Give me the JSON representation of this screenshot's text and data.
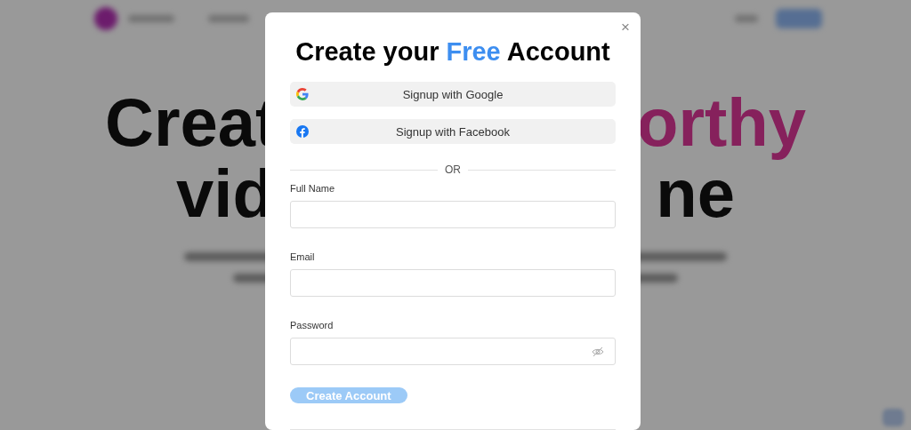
{
  "background_page": {
    "headline": [
      {
        "text": "Creat",
        "accent": false
      },
      {
        "text": "orthy",
        "accent": true
      },
      {
        "text": "vid",
        "accent": false
      },
      {
        "text": "ne",
        "accent": false
      }
    ]
  },
  "modal": {
    "close": "×",
    "title": {
      "before": "Create your",
      "highlight": "Free",
      "after": "Account"
    },
    "social_buttons": [
      {
        "kind": "google",
        "label": "Signup with Google"
      },
      {
        "kind": "facebook",
        "label": "Signup with Facebook"
      }
    ],
    "divider": "OR",
    "fields": [
      {
        "kind": "text",
        "label": "Full Name"
      },
      {
        "kind": "text",
        "label": "Email"
      },
      {
        "kind": "password",
        "label": "Password",
        "reveal": false
      }
    ],
    "submit": {
      "label": "Create Account",
      "disabled": true
    }
  }
}
